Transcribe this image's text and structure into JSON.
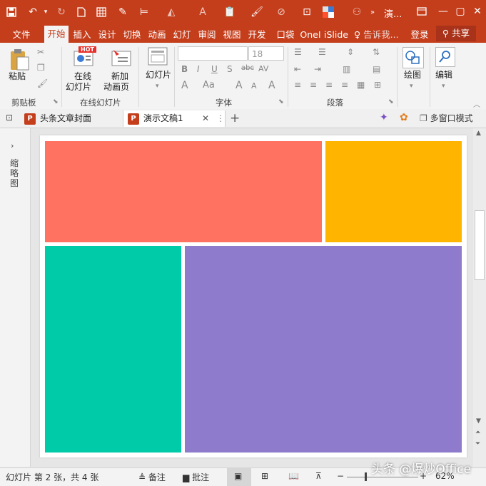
{
  "titlebar": {
    "title": "演...",
    "quick_access": [
      "save-icon",
      "undo-icon",
      "redo-icon",
      "new-file-icon",
      "grid-icon",
      "eyedropper-icon",
      "align-icon",
      "fill-icon",
      "font-color-icon",
      "paste-icon",
      "format-painter-icon",
      "pen-icon",
      "crop-icon",
      "color-swatch-icon",
      "user-group-icon"
    ]
  },
  "tabs": {
    "items": [
      "文件",
      "开始",
      "插入",
      "设计",
      "切换",
      "动画",
      "幻灯",
      "审阅",
      "视图",
      "开发",
      "口袋",
      "OneI",
      "iSlide"
    ],
    "active": "开始",
    "tell_me": "告诉我...",
    "login": "登录",
    "share": "共享"
  },
  "ribbon": {
    "clipboard": {
      "paste": "粘贴",
      "group": "剪贴板"
    },
    "online": {
      "online_slides_1": "在线",
      "online_slides_2": "幻灯片",
      "new_anim_1": "新加",
      "new_anim_2": "动画页",
      "hot_badge": "HOT",
      "group": "在线幻灯片"
    },
    "slides": {
      "label": "幻灯片"
    },
    "font": {
      "font_name": "",
      "font_size": "18",
      "group": "字体",
      "bold": "B",
      "italic": "I",
      "underline": "U",
      "shadow": "S",
      "strike": "abc",
      "spacing": "AV",
      "clear": "A",
      "case": "Aa",
      "grow": "A",
      "shrink": "A",
      "color": "A"
    },
    "paragraph": {
      "group": "段落"
    },
    "drawing": {
      "label": "绘图"
    },
    "editing": {
      "label": "编辑"
    }
  },
  "doctabs": {
    "tab1": "头条文章封面",
    "tab2": "演示文稿1",
    "multi_window": "多窗口模式"
  },
  "leftpanel": {
    "label": "缩略图"
  },
  "slide": {
    "colors": {
      "coral": "#ff7160",
      "amber": "#ffb400",
      "teal": "#00cba9",
      "purple": "#8e7bcb"
    }
  },
  "statusbar": {
    "slide_info": "幻灯片 第 2 张，共 4 张",
    "notes": "备注",
    "comments": "批注",
    "zoom": "62%"
  },
  "watermark": "头条 @爆炒Office"
}
